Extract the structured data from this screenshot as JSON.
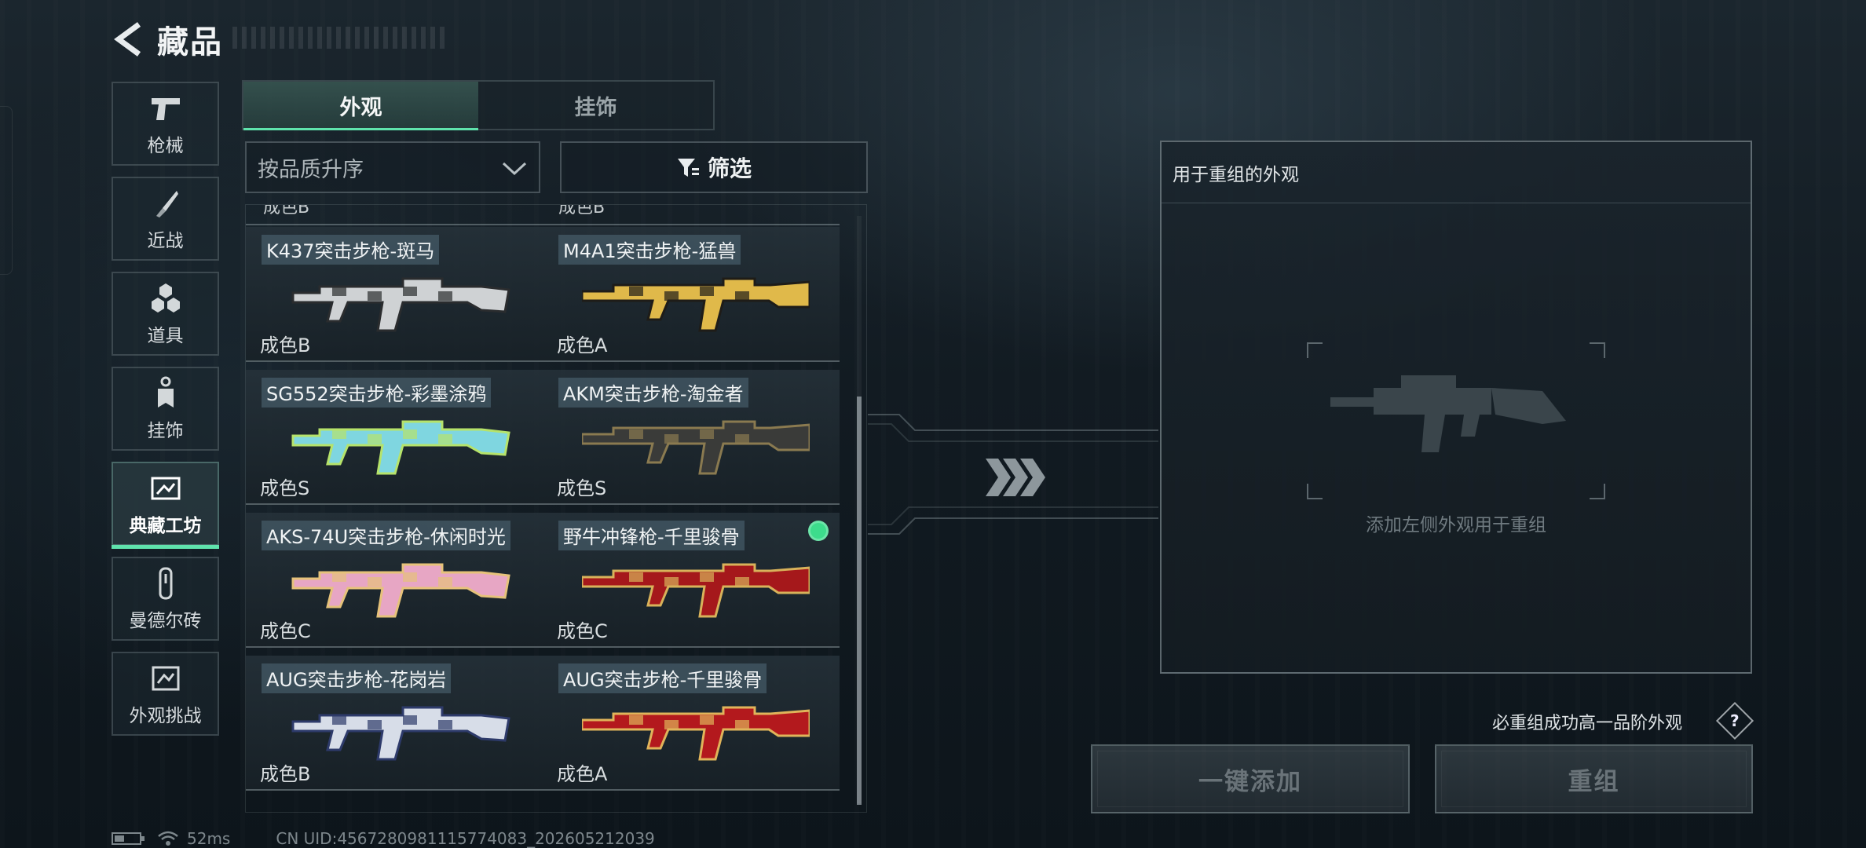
{
  "header": {
    "title": "藏品",
    "back_icon": "back-arrow-icon"
  },
  "sidebar": {
    "items": [
      {
        "label": "枪械",
        "icon": "pistol-icon",
        "active": false
      },
      {
        "label": "近战",
        "icon": "knife-icon",
        "active": false
      },
      {
        "label": "道具",
        "icon": "hexagon-cluster-icon",
        "active": false
      },
      {
        "label": "挂饰",
        "icon": "charm-tag-icon",
        "active": false
      },
      {
        "label": "典藏工坊",
        "icon": "workshop-icon",
        "active": true
      },
      {
        "label": "曼德尔砖",
        "icon": "brick-icon",
        "active": false
      },
      {
        "label": "外观挑战",
        "icon": "challenge-icon",
        "active": false
      }
    ]
  },
  "tabs": [
    {
      "label": "外观",
      "active": true
    },
    {
      "label": "挂饰",
      "active": false
    }
  ],
  "sort": {
    "value": "按品质升序"
  },
  "filter": {
    "label": "筛选"
  },
  "grid": {
    "partial_row": [
      "成色B",
      "成色B"
    ],
    "items": [
      {
        "name": "K437突击步枪-斑马",
        "grade": "成色B",
        "selected": false,
        "colors": [
          "#cfd2d4",
          "#2a2c2e"
        ]
      },
      {
        "name": "M4A1突击步枪-猛兽",
        "grade": "成色A",
        "selected": false,
        "colors": [
          "#e0b94a",
          "#1e1c18"
        ]
      },
      {
        "name": "SG552突击步枪-彩墨涂鸦",
        "grade": "成色S",
        "selected": false,
        "colors": [
          "#7fd6e0",
          "#b6e36a"
        ]
      },
      {
        "name": "AKM突击步枪-淘金者",
        "grade": "成色S",
        "selected": false,
        "colors": [
          "#3a3b39",
          "#8a7a50"
        ]
      },
      {
        "name": "AKS-74U突击步枪-休闲时光",
        "grade": "成色C",
        "selected": false,
        "colors": [
          "#e7a6c4",
          "#e6c27a"
        ]
      },
      {
        "name": "野牛冲锋枪-千里骏骨",
        "grade": "成色C",
        "selected": true,
        "colors": [
          "#a5181b",
          "#d8b25a"
        ]
      },
      {
        "name": "AUG突击步枪-花岗岩",
        "grade": "成色B",
        "selected": false,
        "colors": [
          "#d7dde8",
          "#2d3a6a"
        ]
      },
      {
        "name": "AUG突击步枪-千里骏骨",
        "grade": "成色A",
        "selected": false,
        "colors": [
          "#b3191d",
          "#e0b45a"
        ]
      }
    ]
  },
  "regroup": {
    "title": "用于重组的外观",
    "hint": "添加左侧外观用于重组",
    "note": "必重组成功高一品阶外观",
    "help": "?",
    "add_button": "一键添加",
    "regroup_button": "重组"
  },
  "status": {
    "ping": "52ms",
    "uid": "CN UID:4567280981115774083_202605212039"
  }
}
